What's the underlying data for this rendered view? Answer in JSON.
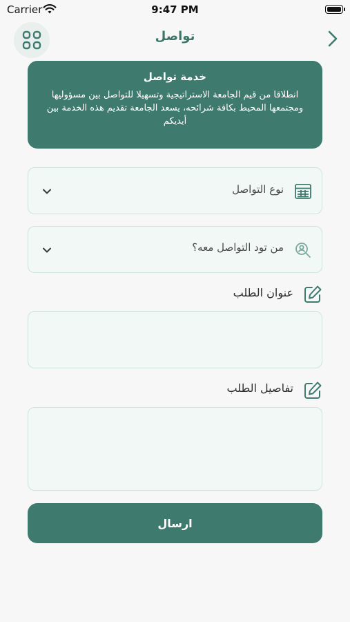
{
  "status_bar": {
    "carrier": "Carrier",
    "time": "9:47 PM"
  },
  "nav": {
    "title": "تواصل",
    "menu_icon": "grid-icon",
    "back_icon": "chevron-right-icon"
  },
  "banner": {
    "title": "خدمة تواصل",
    "text": "انطلاقا من قيم الجامعة الاستراتيجية وتسهيلا للتواصل بين مسؤوليها ومجتمعها المحيط بكافة شرائحه، يسعد الجامعة تقديم هذه الخدمة بين أيديكم"
  },
  "form": {
    "contact_type": {
      "placeholder": "نوع التواصل",
      "icon": "table-icon"
    },
    "contact_person": {
      "placeholder": "من تود التواصل معه؟",
      "icon": "user-search-icon"
    },
    "request_title": {
      "label": "عنوان الطلب",
      "value": "",
      "icon": "edit-icon"
    },
    "request_details": {
      "label": "تفاصيل الطلب",
      "value": "",
      "icon": "edit-icon"
    },
    "submit_label": "ارسال"
  },
  "colors": {
    "primary": "#3f7a6e",
    "field_bg": "#f1f8f5",
    "field_border": "#cfe3dc",
    "page_bg": "#f7f7f7"
  }
}
